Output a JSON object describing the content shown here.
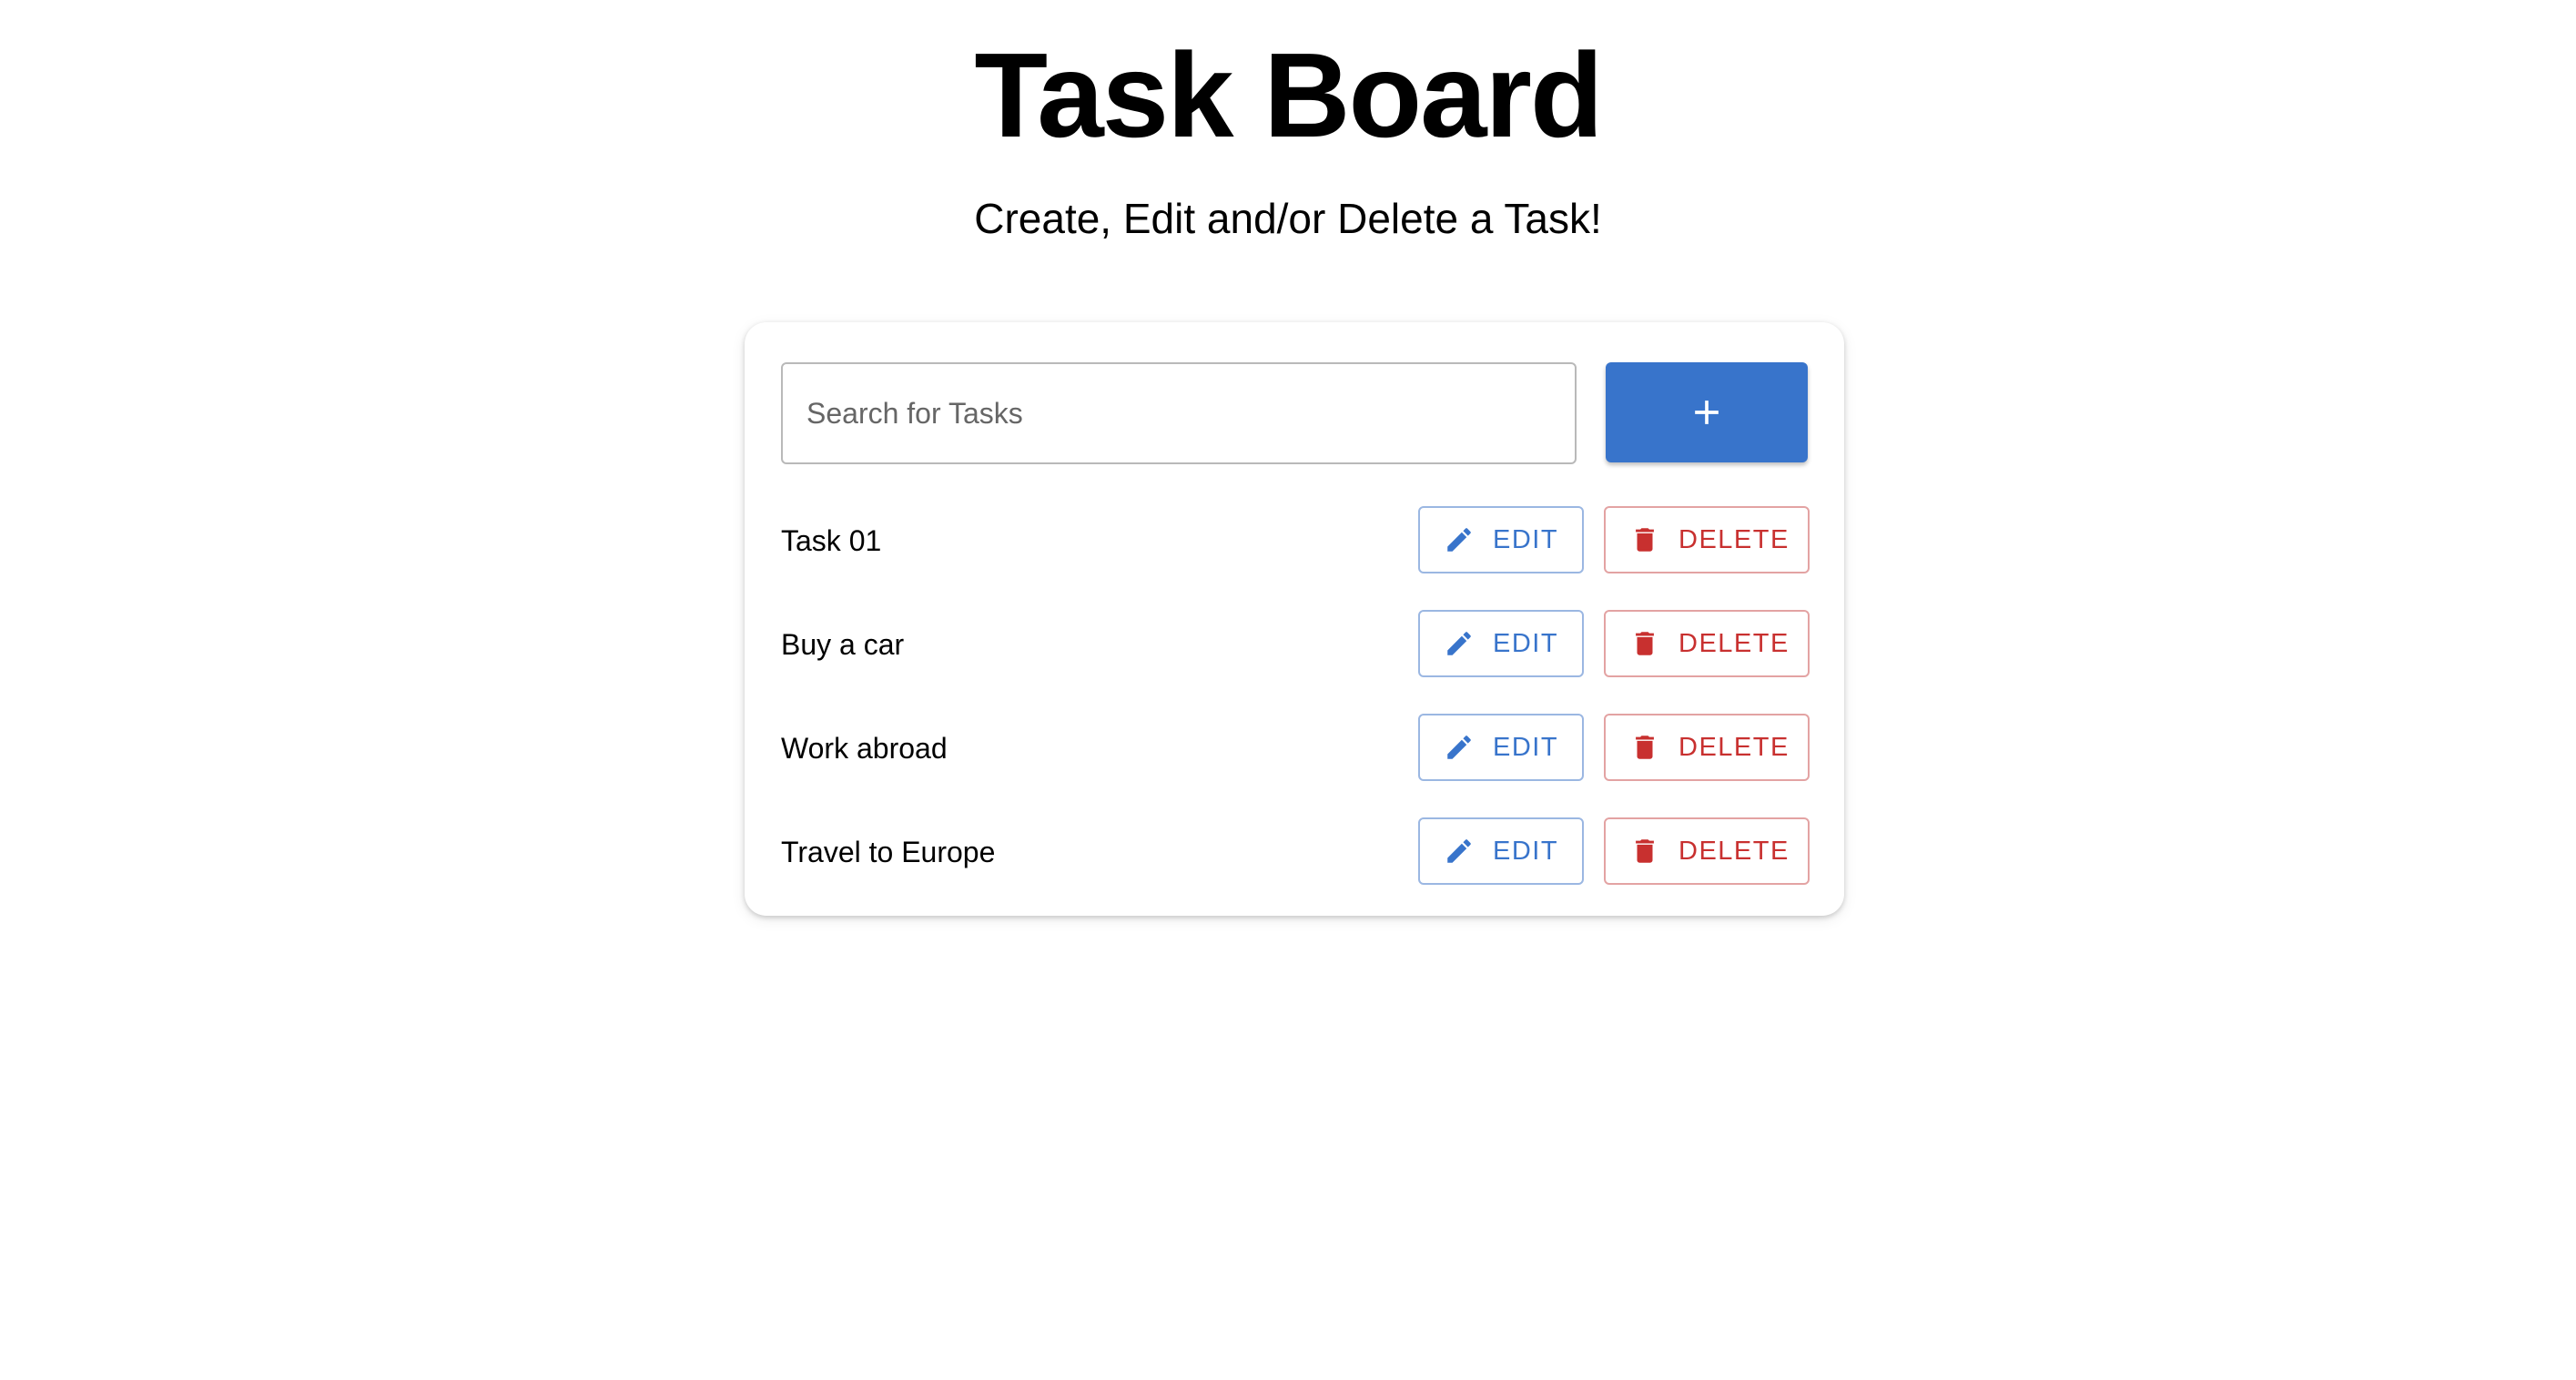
{
  "header": {
    "title": "Task Board",
    "subtitle": "Create, Edit and/or Delete a Task!"
  },
  "search": {
    "placeholder": "Search for Tasks",
    "value": ""
  },
  "add_button": {
    "icon": "plus-icon"
  },
  "actions": {
    "edit_label": "EDIT",
    "edit_icon": "pencil-icon",
    "delete_label": "DELETE",
    "delete_icon": "trash-icon"
  },
  "tasks": [
    {
      "name": "Task 01"
    },
    {
      "name": "Buy a car"
    },
    {
      "name": "Work abroad"
    },
    {
      "name": "Travel to Europe"
    }
  ],
  "colors": {
    "primary": "#3874cb",
    "danger": "#c8302f"
  }
}
